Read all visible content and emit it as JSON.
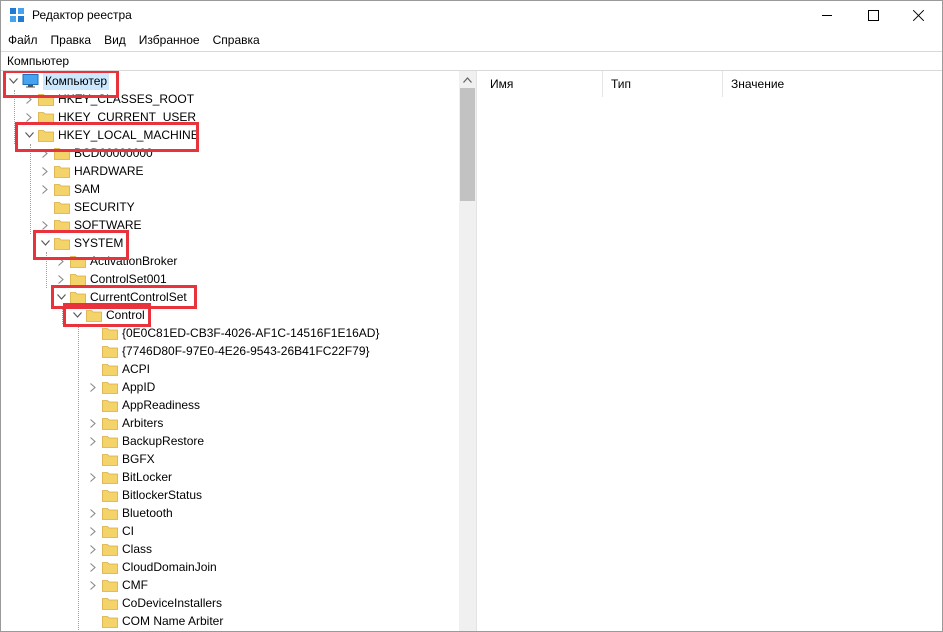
{
  "window": {
    "title": "Редактор реестра",
    "controls": [
      "minimize",
      "maximize",
      "close"
    ]
  },
  "menu": [
    "Файл",
    "Правка",
    "Вид",
    "Избранное",
    "Справка"
  ],
  "address": "Компьютер",
  "columns": [
    "Имя",
    "Тип",
    "Значение"
  ],
  "tree": [
    {
      "label": "Компьютер",
      "depth": 0,
      "state": "expanded",
      "icon": "computer-icon",
      "selected": true
    },
    {
      "label": "HKEY_CLASSES_ROOT",
      "depth": 1,
      "state": "collapsed"
    },
    {
      "label": "HKEY_CURRENT_USER",
      "depth": 1,
      "state": "collapsed"
    },
    {
      "label": "HKEY_LOCAL_MACHINE",
      "depth": 1,
      "state": "expanded"
    },
    {
      "label": "BCD00000000",
      "depth": 2,
      "state": "collapsed"
    },
    {
      "label": "HARDWARE",
      "depth": 2,
      "state": "collapsed"
    },
    {
      "label": "SAM",
      "depth": 2,
      "state": "collapsed"
    },
    {
      "label": "SECURITY",
      "depth": 2,
      "state": "leaf"
    },
    {
      "label": "SOFTWARE",
      "depth": 2,
      "state": "collapsed"
    },
    {
      "label": "SYSTEM",
      "depth": 2,
      "state": "expanded"
    },
    {
      "label": "ActivationBroker",
      "depth": 3,
      "state": "collapsed"
    },
    {
      "label": "ControlSet001",
      "depth": 3,
      "state": "collapsed"
    },
    {
      "label": "CurrentControlSet",
      "depth": 3,
      "state": "expanded"
    },
    {
      "label": "Control",
      "depth": 4,
      "state": "expanded"
    },
    {
      "label": "{0E0C81ED-CB3F-4026-AF1C-14516F1E16AD}",
      "depth": 5,
      "state": "leaf"
    },
    {
      "label": "{7746D80F-97E0-4E26-9543-26B41FC22F79}",
      "depth": 5,
      "state": "leaf"
    },
    {
      "label": "ACPI",
      "depth": 5,
      "state": "leaf"
    },
    {
      "label": "AppID",
      "depth": 5,
      "state": "collapsed"
    },
    {
      "label": "AppReadiness",
      "depth": 5,
      "state": "leaf"
    },
    {
      "label": "Arbiters",
      "depth": 5,
      "state": "collapsed"
    },
    {
      "label": "BackupRestore",
      "depth": 5,
      "state": "collapsed"
    },
    {
      "label": "BGFX",
      "depth": 5,
      "state": "leaf"
    },
    {
      "label": "BitLocker",
      "depth": 5,
      "state": "collapsed"
    },
    {
      "label": "BitlockerStatus",
      "depth": 5,
      "state": "leaf"
    },
    {
      "label": "Bluetooth",
      "depth": 5,
      "state": "collapsed"
    },
    {
      "label": "CI",
      "depth": 5,
      "state": "collapsed"
    },
    {
      "label": "Class",
      "depth": 5,
      "state": "collapsed"
    },
    {
      "label": "CloudDomainJoin",
      "depth": 5,
      "state": "collapsed"
    },
    {
      "label": "CMF",
      "depth": 5,
      "state": "collapsed"
    },
    {
      "label": "CoDeviceInstallers",
      "depth": 5,
      "state": "leaf"
    },
    {
      "label": "COM Name Arbiter",
      "depth": 5,
      "state": "leaf"
    }
  ],
  "highlighted": [
    "Компьютер",
    "HKEY_LOCAL_MACHINE",
    "SYSTEM",
    "CurrentControlSet",
    "Control"
  ],
  "colors": {
    "highlight": "#e8323c",
    "folder": "#f5d36b",
    "selection": "#cce8ff"
  }
}
